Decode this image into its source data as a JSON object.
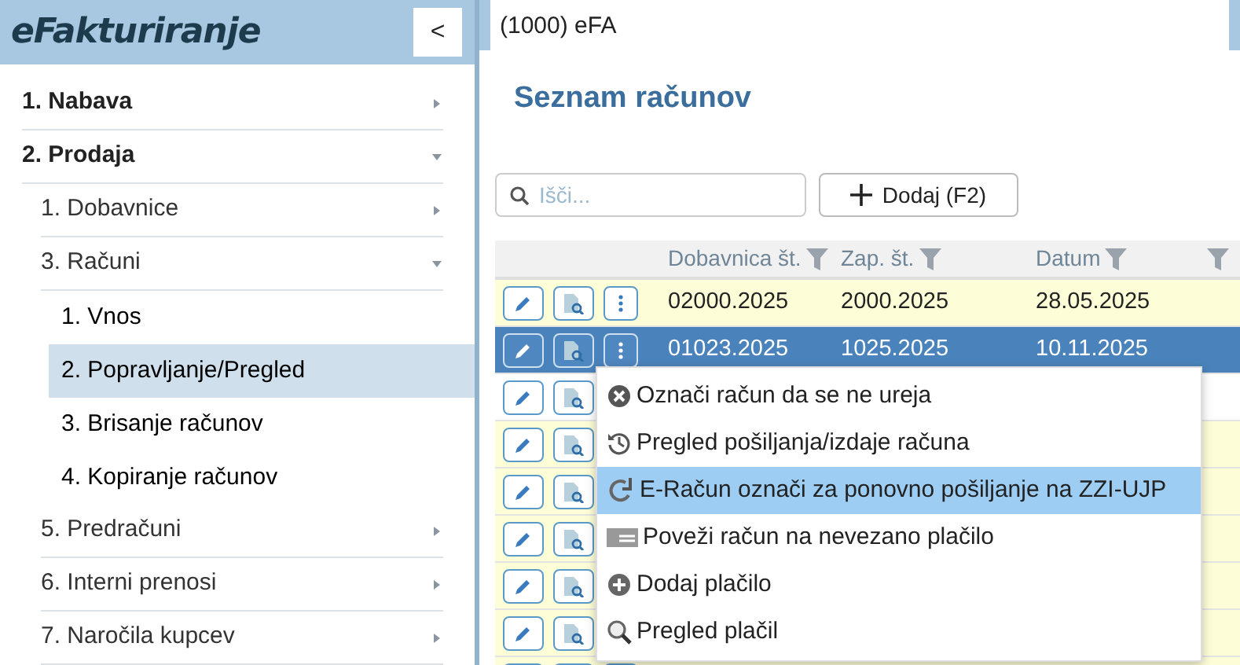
{
  "app": {
    "title": "eFakturiranje",
    "collapse_icon": "<"
  },
  "top_bar": {
    "value": "(1000) eFA"
  },
  "sidebar": {
    "items": [
      {
        "label": "1. Nabava",
        "expanded": false,
        "selected": false
      },
      {
        "label": "2. Prodaja",
        "expanded": true,
        "selected": false,
        "children": [
          {
            "label": "1. Dobavnice",
            "expanded": false,
            "selected": false
          },
          {
            "label": "3. Računi",
            "expanded": true,
            "selected": false,
            "children": [
              {
                "label": "1. Vnos",
                "selected": false
              },
              {
                "label": "2. Popravljanje/Pregled",
                "selected": true
              },
              {
                "label": "3. Brisanje računov",
                "selected": false
              },
              {
                "label": "4. Kopiranje računov",
                "selected": false
              }
            ]
          },
          {
            "label": "5. Predračuni",
            "expanded": false,
            "selected": false
          },
          {
            "label": "6. Interni prenosi",
            "expanded": false,
            "selected": false
          },
          {
            "label": "7. Naročila kupcev",
            "expanded": false,
            "selected": false
          }
        ]
      }
    ]
  },
  "page": {
    "title": "Seznam računov"
  },
  "search": {
    "placeholder": "Išči..."
  },
  "add_button": {
    "label": "Dodaj (F2)"
  },
  "table": {
    "columns": [
      "Dobavnica št.",
      "Zap. št.",
      "Datum",
      ""
    ],
    "rows": [
      {
        "selected": false,
        "tinted": true,
        "cells": [
          "02000.2025",
          "2000.2025",
          "28.05.2025"
        ]
      },
      {
        "selected": true,
        "cells": [
          "01023.2025",
          "1025.2025",
          "10.11.2025"
        ]
      },
      {
        "selected": false,
        "tinted": false,
        "cells": []
      },
      {
        "selected": false,
        "tinted": true,
        "cells": []
      },
      {
        "selected": false,
        "tinted": true,
        "cells": []
      },
      {
        "selected": false,
        "tinted": true,
        "cells": []
      },
      {
        "selected": false,
        "tinted": true,
        "cells": []
      },
      {
        "selected": false,
        "tinted": true,
        "cells": []
      },
      {
        "selected": false,
        "tinted": true,
        "cells": []
      }
    ]
  },
  "context_menu": {
    "items": [
      {
        "kind": "cancel",
        "label": "Označi račun da se ne ureja",
        "selected": false
      },
      {
        "kind": "history",
        "label": "Pregled pošiljanja/izdaje računa",
        "selected": false
      },
      {
        "kind": "resend",
        "label": "E-Račun označi za ponovno pošiljanje na ZZI-UJP",
        "selected": true
      },
      {
        "kind": "link",
        "label": "Poveži račun na nevezano plačilo",
        "selected": false
      },
      {
        "kind": "add",
        "label": "Dodaj plačilo",
        "selected": false
      },
      {
        "kind": "search",
        "label": "Pregled plačil",
        "selected": false
      }
    ]
  }
}
